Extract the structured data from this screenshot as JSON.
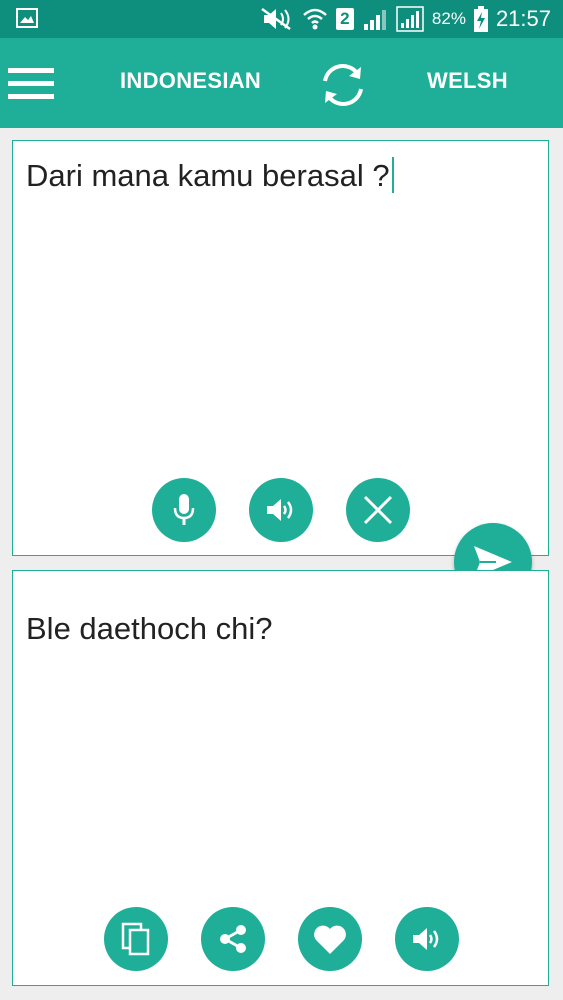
{
  "status_bar": {
    "battery_percent": "82%",
    "time": "21:57",
    "sim_slot": "2"
  },
  "app_bar": {
    "source_language": "INDONESIAN",
    "target_language": "WELSH"
  },
  "source_panel": {
    "text": "Dari mana kamu berasal ?"
  },
  "target_panel": {
    "text": "Ble daethoch chi?"
  },
  "icons": {
    "menu": "menu-icon",
    "swap": "swap-languages-icon",
    "mic": "microphone-icon",
    "speaker": "speaker-icon",
    "clear": "close-icon",
    "send": "send-icon",
    "copy": "copy-icon",
    "share": "share-icon",
    "favorite": "heart-icon"
  },
  "colors": {
    "status_bar": "#0e8f7e",
    "accent": "#1fae97",
    "background": "#eeeeee"
  }
}
